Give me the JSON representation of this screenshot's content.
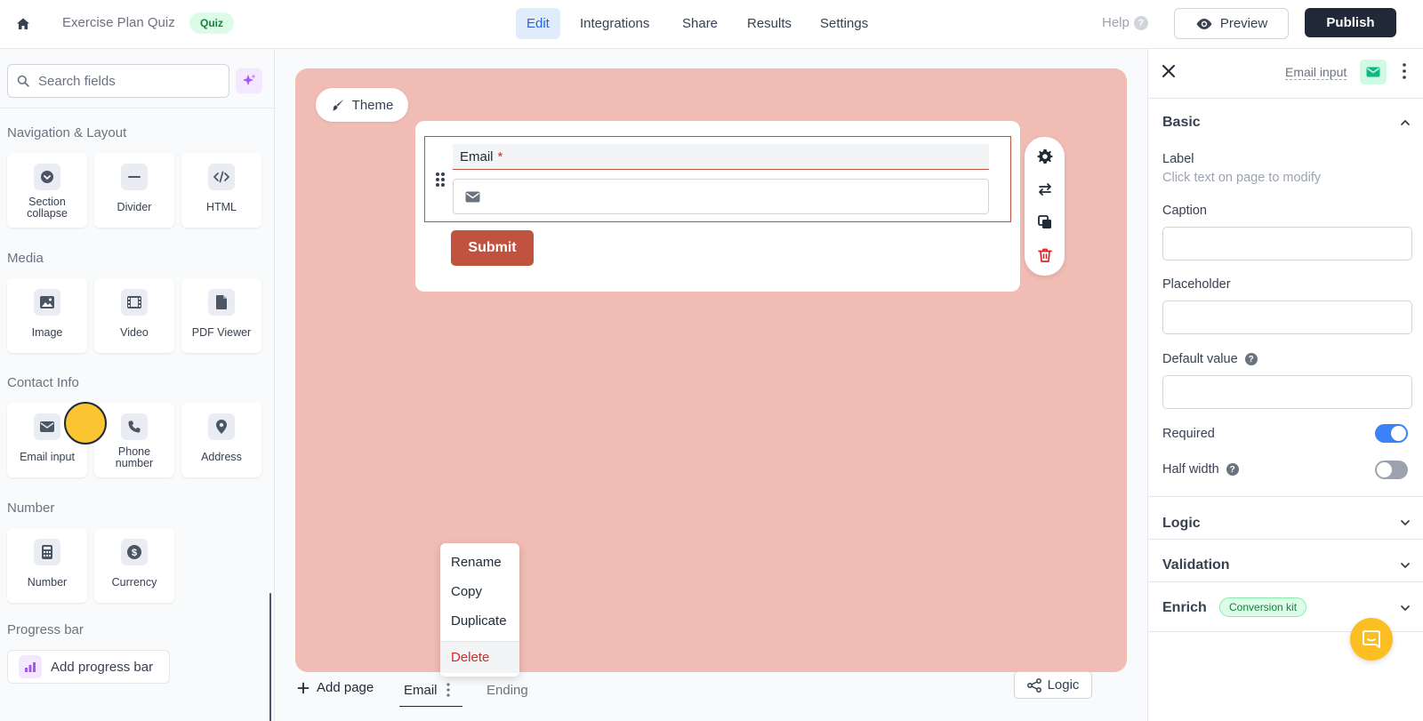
{
  "topbar": {
    "form_title": "Exercise Plan Quiz",
    "badge": "Quiz",
    "tabs": [
      {
        "label": "Edit",
        "active": true
      },
      {
        "label": "Integrations",
        "active": false
      },
      {
        "label": "Share",
        "active": false
      },
      {
        "label": "Results",
        "active": false
      },
      {
        "label": "Settings",
        "active": false
      }
    ],
    "help_label": "Help",
    "help_icon": "?",
    "preview_label": "Preview",
    "publish_label": "Publish"
  },
  "sidebar": {
    "search_placeholder": "Search fields",
    "sections": {
      "nav_layout": "Navigation & Layout",
      "media": "Media",
      "contact": "Contact Info",
      "number": "Number",
      "progress": "Progress bar"
    },
    "tiles": {
      "section_collapse": "Section collapse",
      "divider": "Divider",
      "html": "HTML",
      "image": "Image",
      "video": "Video",
      "pdf_viewer": "PDF Viewer",
      "email_input": "Email input",
      "phone_number": "Phone number",
      "address": "Address",
      "number": "Number",
      "currency": "Currency"
    },
    "progress_button": "Add progress bar"
  },
  "canvas": {
    "theme_label": "Theme",
    "background": "#f0bcb4",
    "accent": "#c0533f",
    "field_label": "Email",
    "required_mark": "*",
    "submit_label": "Submit",
    "page_menu": {
      "rename": "Rename",
      "copy": "Copy",
      "duplicate": "Duplicate",
      "delete": "Delete"
    },
    "pages_bar": {
      "add_page": "Add page",
      "current_page": "Email",
      "ending_page": "Ending",
      "logic": "Logic"
    }
  },
  "rpanel": {
    "title": "Email input",
    "basic": "Basic",
    "label": "Label",
    "label_hint": "Click text on page to modify",
    "caption": "Caption",
    "caption_value": "",
    "placeholder": "Placeholder",
    "placeholder_value": "",
    "default_value": "Default value",
    "default_value_value": "",
    "required": "Required",
    "required_on": true,
    "half_width": "Half width",
    "half_width_on": false,
    "logic": "Logic",
    "validation": "Validation",
    "enrich": "Enrich",
    "enrich_badge": "Conversion kit"
  }
}
